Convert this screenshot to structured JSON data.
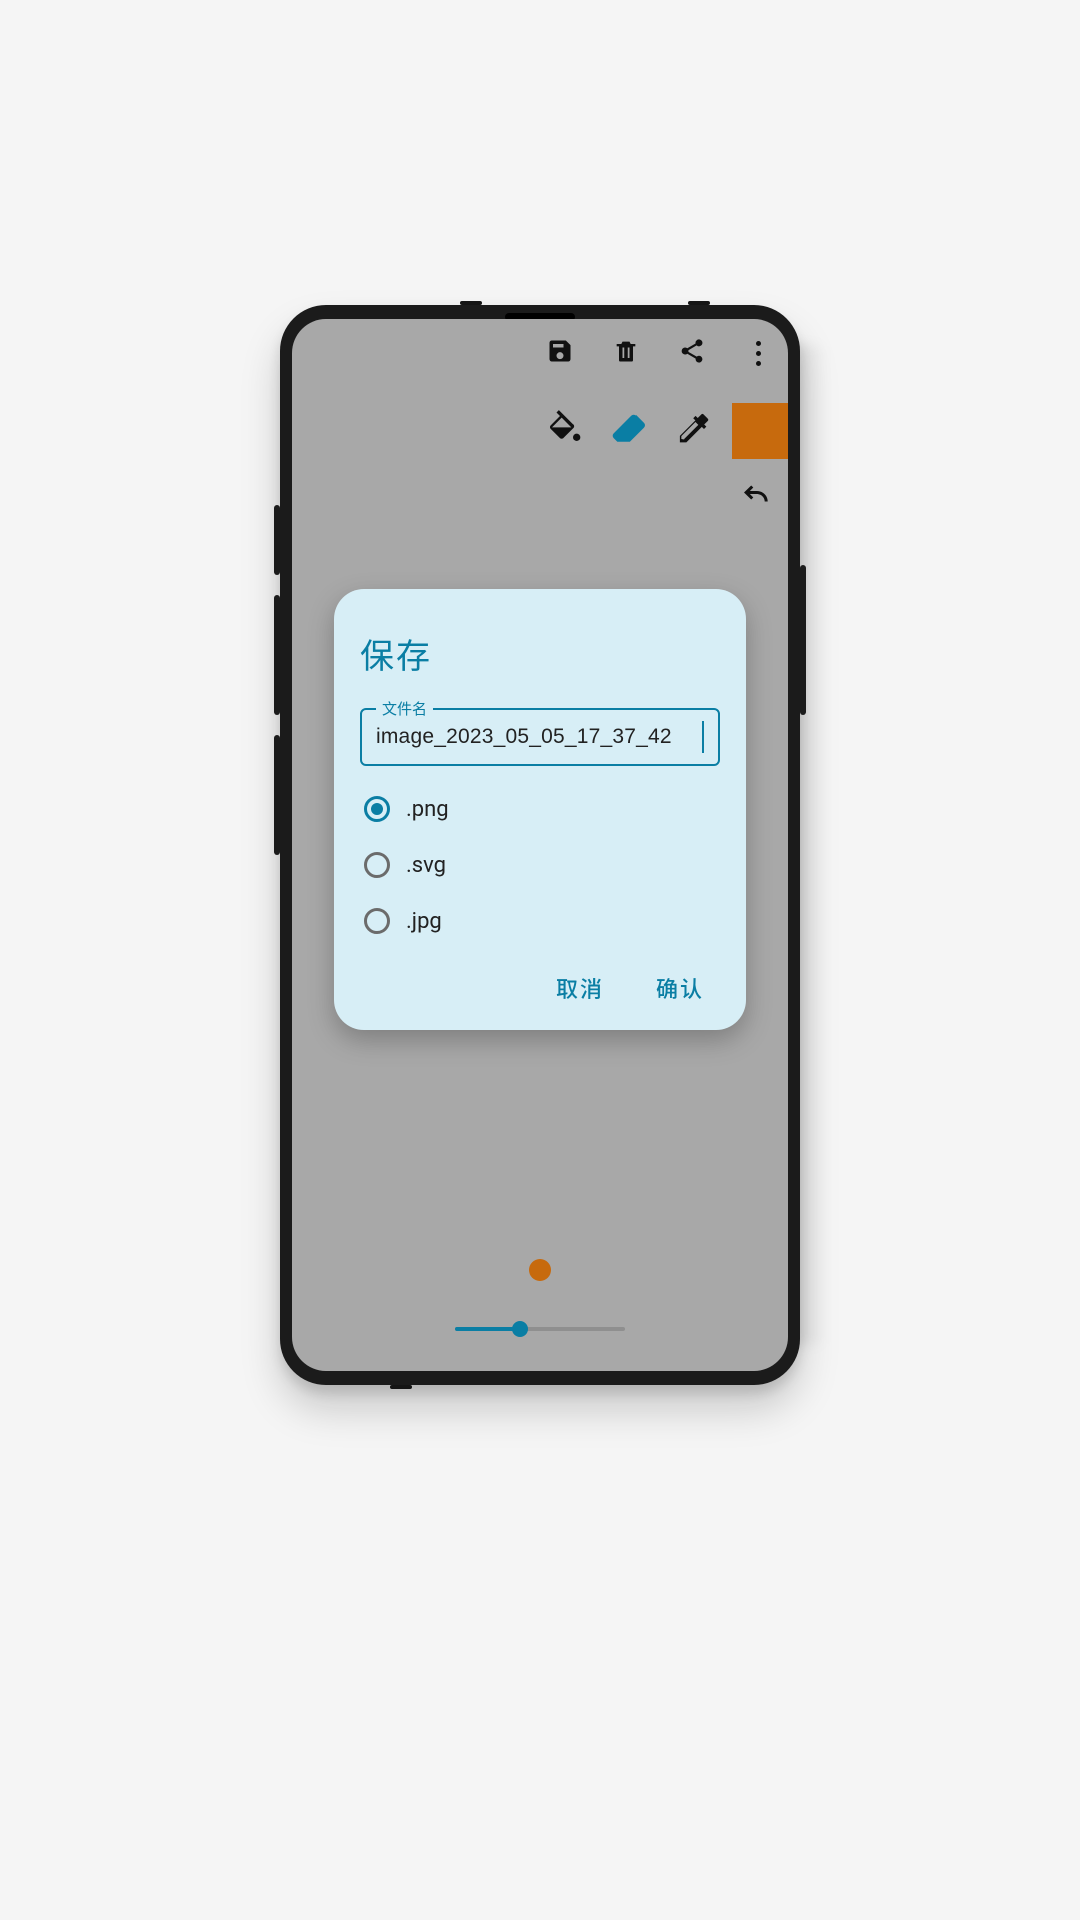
{
  "colors": {
    "accent": "#0a7ea4",
    "swatch": "#c76a0d"
  },
  "topbar": {
    "save_icon": "save",
    "delete_icon": "trash",
    "share_icon": "share",
    "overflow_icon": "more"
  },
  "tools": {
    "fill_icon": "paint-bucket",
    "eraser_icon": "eraser",
    "eyedropper_icon": "eyedropper",
    "active_tool": "eraser"
  },
  "undo_icon": "undo",
  "brush": {
    "preview_color": "#c76a0d",
    "slider_value_pct": 38
  },
  "dialog": {
    "title": "保存",
    "filename_legend": "文件名",
    "filename_value": "image_2023_05_05_17_37_42",
    "formats": [
      {
        "label": ".png",
        "selected": true
      },
      {
        "label": ".svg",
        "selected": false
      },
      {
        "label": ".jpg",
        "selected": false
      }
    ],
    "cancel_label": "取消",
    "confirm_label": "确认"
  }
}
